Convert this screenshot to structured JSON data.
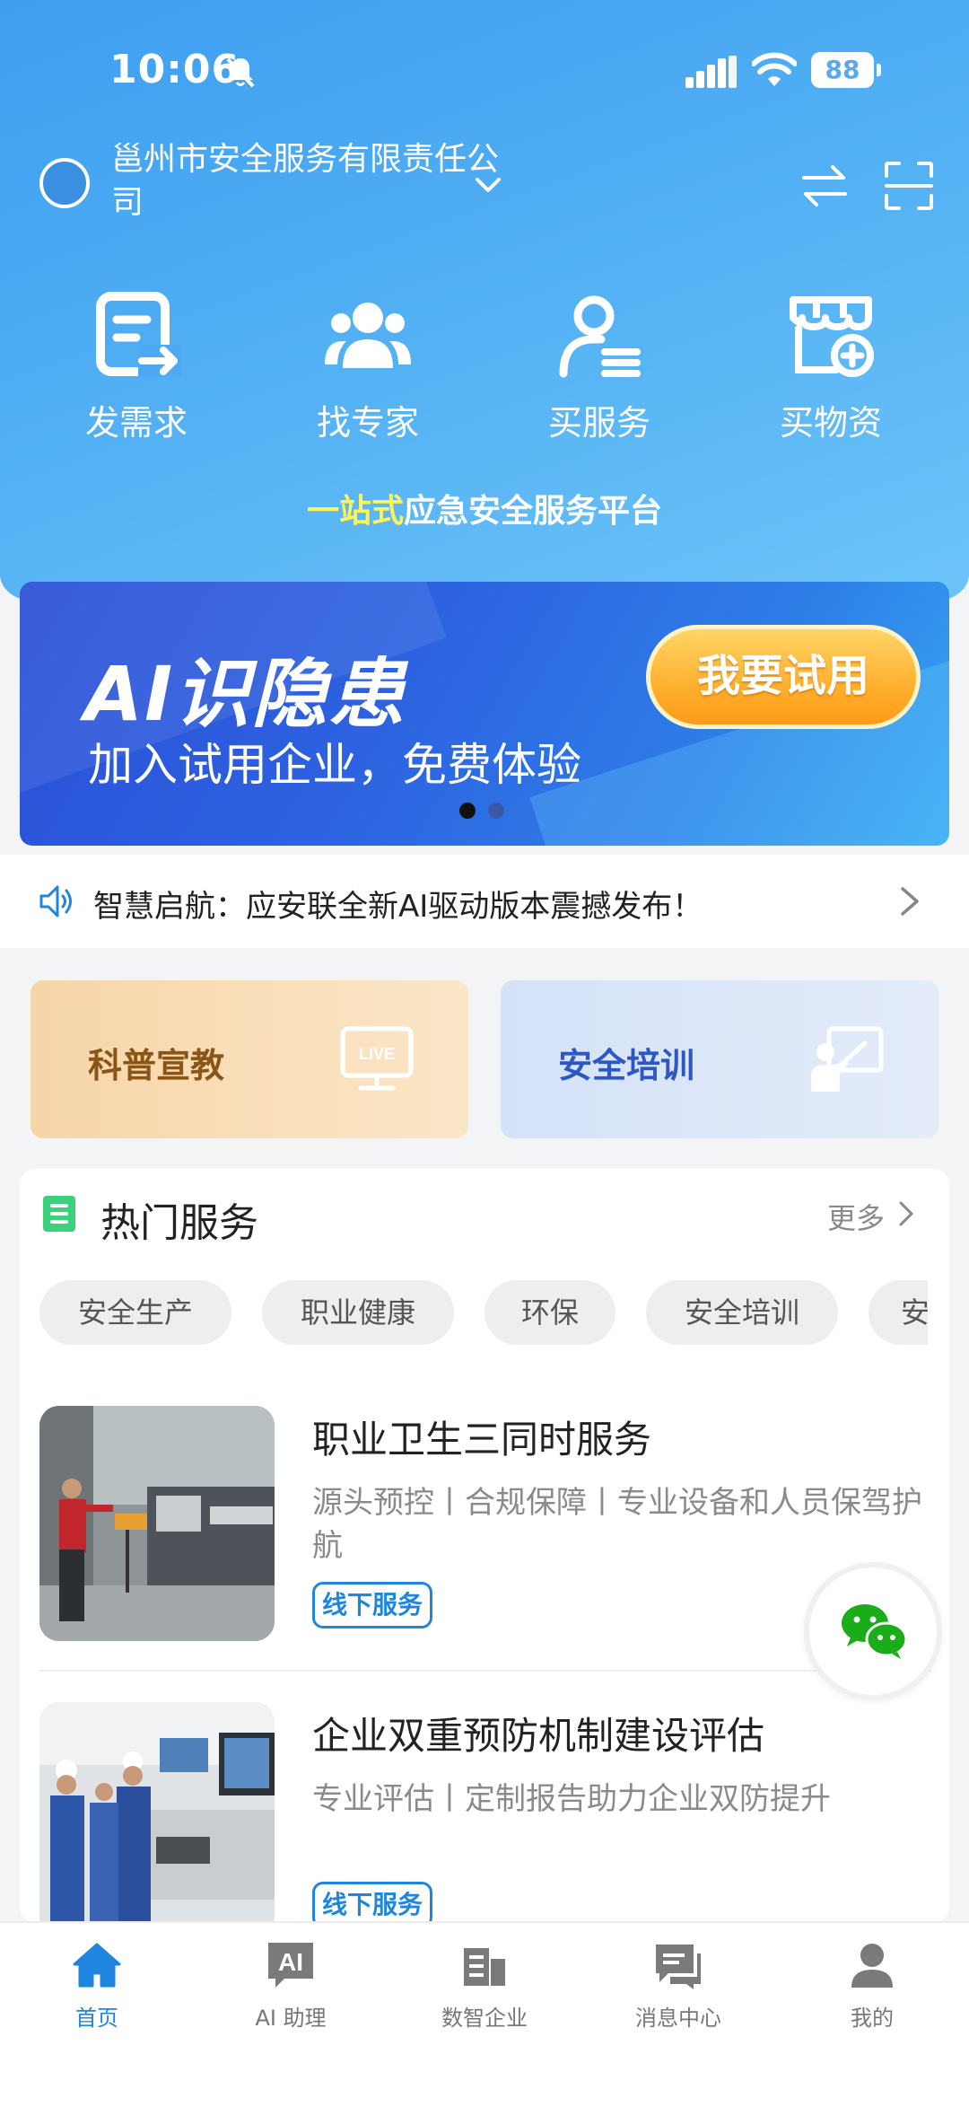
{
  "status_bar": {
    "time": "10:06",
    "battery": "88"
  },
  "header": {
    "company_name": "邕州市安全服务有限责任公司"
  },
  "quick_actions": [
    {
      "label": "发需求",
      "icon": "post-demand-icon"
    },
    {
      "label": "找专家",
      "icon": "find-expert-icon"
    },
    {
      "label": "买服务",
      "icon": "buy-service-icon"
    },
    {
      "label": "买物资",
      "icon": "buy-supplies-icon"
    }
  ],
  "slogan": {
    "highlight": "一站式",
    "rest": "应急安全服务平台"
  },
  "banner": {
    "title": "AI识隐患",
    "subtitle": "加入试用企业，免费体验",
    "button": "我要试用",
    "current_slide": 1,
    "total_slides": 2
  },
  "notice": {
    "text": "智慧启航：应安联全新AI驱动版本震撼发布！"
  },
  "feature_cards": [
    {
      "label": "科普宣教",
      "icon": "live-tv-icon"
    },
    {
      "label": "安全培训",
      "icon": "teacher-board-icon"
    }
  ],
  "hot_services": {
    "title": "热门服务",
    "more": "更多",
    "chips": [
      "安全生产",
      "职业健康",
      "环保",
      "安全培训",
      "安"
    ],
    "items": [
      {
        "title": "职业卫生三同时服务",
        "desc": "源头预控丨合规保障丨专业设备和人员保驾护航",
        "tag": "线下服务"
      },
      {
        "title": "企业双重预防机制建设评估",
        "desc": "专业评估丨定制报告助力企业双防提升",
        "tag": "线下服务"
      }
    ]
  },
  "tabbar": [
    {
      "label": "首页",
      "icon": "home-icon",
      "active": true
    },
    {
      "label": "AI 助理",
      "icon": "ai-assistant-icon",
      "active": false
    },
    {
      "label": "数智企业",
      "icon": "enterprise-icon",
      "active": false
    },
    {
      "label": "消息中心",
      "icon": "message-icon",
      "active": false
    },
    {
      "label": "我的",
      "icon": "profile-icon",
      "active": false
    }
  ],
  "colors": {
    "primary_blue": "#1f86e0",
    "hero_gradient_start": "#3e9ef0",
    "hero_gradient_end": "#6cc4f8",
    "slogan_highlight": "#fff35a",
    "hot_icon_green": "#3bd07a"
  }
}
